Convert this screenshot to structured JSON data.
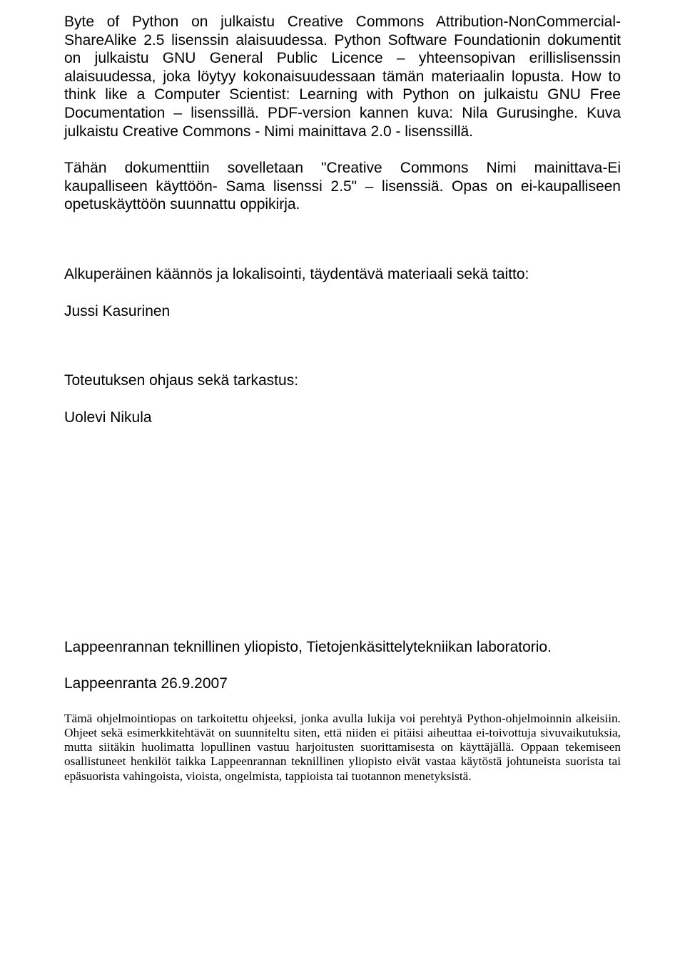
{
  "paragraphs": {
    "p1": "Byte of Python on julkaistu Creative Commons Attribution-NonCommercial-ShareAlike 2.5 lisenssin alaisuudessa. Python Software Foundationin dokumentit on julkaistu GNU General Public Licence – yhteensopivan erillislisenssin alaisuudessa, joka löytyy kokonaisuudessaan tämän materiaalin lopusta. How to think like a Computer Scientist: Learning with Python on julkaistu GNU Free Documentation – lisenssillä. PDF-version kannen kuva: Nila Gurusinghe. Kuva julkaistu Creative Commons - Nimi mainittava 2.0 - lisenssillä.",
    "p2": "Tähän dokumenttiin sovelletaan \"Creative Commons Nimi mainittava-Ei kaupalliseen käyttöön- Sama lisenssi 2.5\" – lisenssiä. Opas on ei-kaupalliseen opetuskäyttöön suunnattu oppikirja.",
    "p3": "Alkuperäinen käännös ja lokalisointi, täydentävä materiaali sekä taitto:",
    "name1": "Jussi Kasurinen",
    "p4": "Toteutuksen ohjaus sekä tarkastus:",
    "name2": "Uolevi Nikula",
    "p5": "Lappeenrannan teknillinen yliopisto, Tietojenkäsittelytekniikan laboratorio.",
    "p6": "Lappeenranta 26.9.2007",
    "disclaimer": "Tämä ohjelmointiopas on tarkoitettu ohjeeksi, jonka avulla lukija voi perehtyä Python-ohjelmoinnin alkeisiin. Ohjeet sekä esimerkkitehtävät on suunniteltu siten, että niiden ei pitäisi aiheuttaa ei-toivottuja sivuvaikutuksia, mutta siitäkin huolimatta lopullinen vastuu harjoitusten suorittamisesta on käyttäjällä. Oppaan tekemiseen osallistuneet henkilöt taikka Lappeenrannan teknillinen yliopisto eivät vastaa käytöstä johtuneista suorista tai epäsuorista vahingoista, vioista, ongelmista, tappioista tai tuotannon menetyksistä."
  }
}
